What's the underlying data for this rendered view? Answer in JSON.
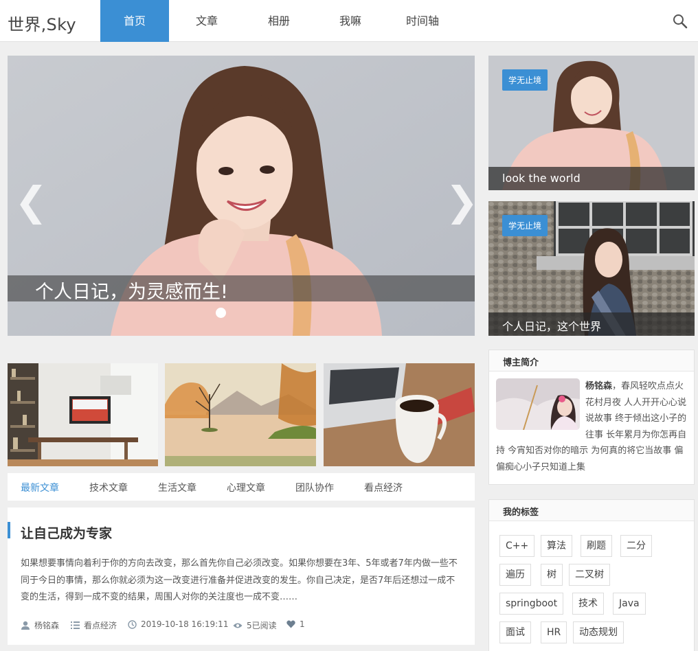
{
  "header": {
    "logo": "世界,Sky",
    "nav": [
      "首页",
      "文章",
      "相册",
      "我嘛",
      "时间轴"
    ],
    "active_nav": "首页"
  },
  "slider": {
    "caption": "个人日记，为灵感而生!",
    "prev": "❮",
    "next": "❯"
  },
  "side_cards": [
    {
      "badge": "学无止境",
      "caption": "look the world"
    },
    {
      "badge": "学无止境",
      "caption": "个人日记，这个世界"
    }
  ],
  "tabs": [
    "最新文章",
    "技术文章",
    "生活文章",
    "心理文章",
    "团队协作",
    "看点经济"
  ],
  "article": {
    "title": "让自己成为专家",
    "excerpt": "如果想要事情向着利于你的方向去改变，那么首先你自己必须改变。如果你想要在3年、5年或者7年内做一些不同于今日的事情，那么你就必须为这一改变进行准备并促进改变的发生。你自己决定，是否7年后还想过一成不变的生活，得到一成不变的结果，周围人对你的关注度也一成不变……",
    "author": "杨铭森",
    "category": "看点经济",
    "date": "2019-10-18 16:19:11",
    "views": "5已阅读",
    "likes": "1"
  },
  "intro": {
    "title": "博主简介",
    "name": "杨铭森",
    "text": "，春风轻吹点点火花村月夜 人人开开心心说说故事 终于倾出这小子的往事 长年累月为你怎再自持 今宵知否对你的暗示 为何真的将它当故事 偏偏痴心小子只知道上集"
  },
  "tags": {
    "title": "我的标签",
    "items": [
      "C++",
      "算法",
      "刷题",
      "二分",
      "遍历",
      "树",
      "二叉树",
      "springboot",
      "技术",
      "Java",
      "面试",
      "HR",
      "动态规划"
    ]
  },
  "colors": {
    "accent": "#3b8fd4"
  }
}
